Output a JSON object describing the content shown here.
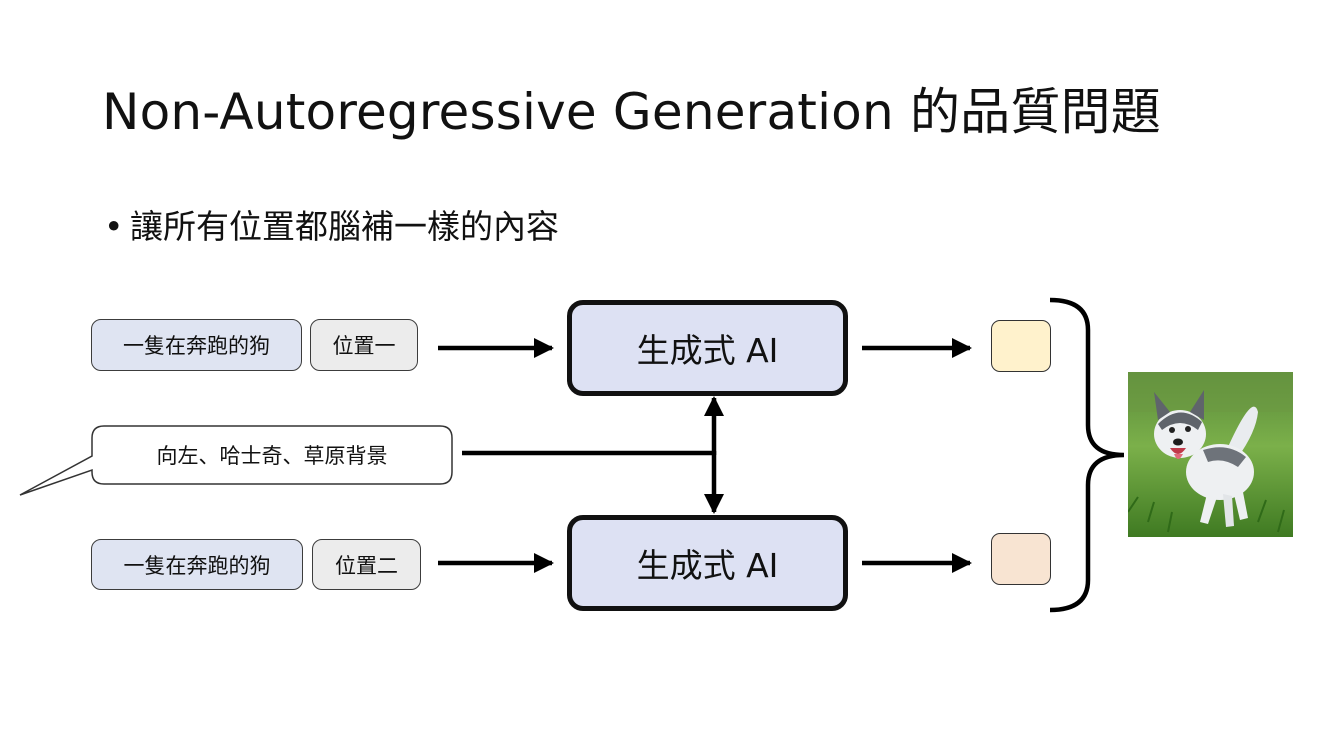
{
  "title": "Non-Autoregressive Generation 的品質問題",
  "bullet": "讓所有位置都腦補一樣的內容",
  "row1": {
    "prompt": "一隻在奔跑的狗",
    "position": "位置一",
    "model": "生成式 AI",
    "output_color": "#fff2cc"
  },
  "row2": {
    "prompt": "一隻在奔跑的狗",
    "position": "位置二",
    "model": "生成式 AI",
    "output_color": "#f8e4d2"
  },
  "speech_bubble": "向左、哈士奇、草原背景",
  "colors": {
    "prompt_fill": "#dfe4f2",
    "position_fill": "#ececec",
    "model_fill": "#dde1f3"
  },
  "image": {
    "icon": "husky-running-on-grass-photo"
  }
}
